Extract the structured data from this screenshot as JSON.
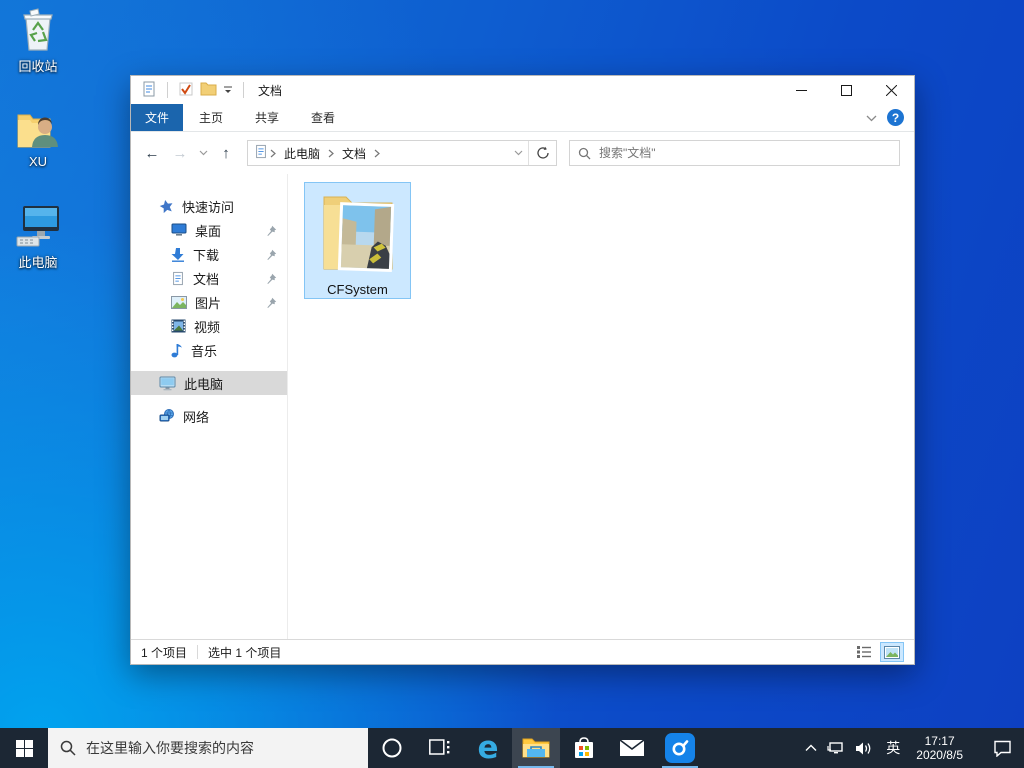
{
  "colors": {
    "accent": "#0078d7",
    "selection_bg": "#cce8ff",
    "selection_border": "#84c5f5",
    "file_tab_bg": "#1b65ad",
    "taskbar_bg": "#1c2734",
    "desktop_left": "#00a6f0",
    "desktop_right": "#0d40c2"
  },
  "desktop": {
    "icons": [
      {
        "label": "回收站"
      },
      {
        "label": "XU"
      },
      {
        "label": "此电脑"
      }
    ]
  },
  "explorer": {
    "title": "文档",
    "tabs": {
      "file": "文件",
      "home": "主页",
      "share": "共享",
      "view": "查看"
    },
    "breadcrumb": {
      "segments": [
        "此电脑",
        "文档"
      ]
    },
    "search_placeholder": "搜索\"文档\"",
    "sidebar": [
      {
        "label": "快速访问"
      },
      {
        "label": "桌面"
      },
      {
        "label": "下载"
      },
      {
        "label": "文档"
      },
      {
        "label": "图片"
      },
      {
        "label": "视频"
      },
      {
        "label": "音乐"
      },
      {
        "label": "此电脑"
      },
      {
        "label": "网络"
      }
    ],
    "files": [
      {
        "name": "CFSystem"
      }
    ],
    "status": {
      "items_count": "1 个项目",
      "selected_count": "选中 1 个项目"
    }
  },
  "taskbar": {
    "search_placeholder": "在这里输入你要搜索的内容",
    "tray": {
      "input_lang": "英",
      "time": "17:17",
      "date": "2020/8/5"
    }
  }
}
